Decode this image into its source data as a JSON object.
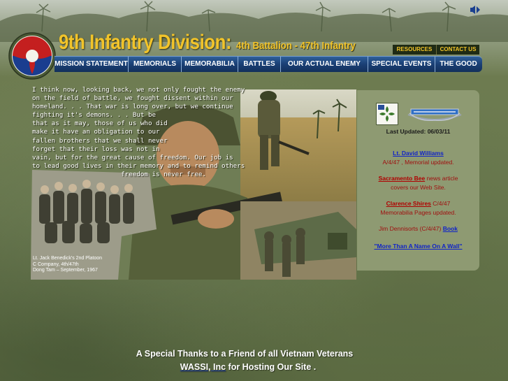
{
  "header": {
    "title_main": "9th Infantry Division:",
    "title_sub": "4th Battalion - 47th Infantry",
    "top_links": [
      "RESOURCES",
      "CONTACT US"
    ]
  },
  "nav": {
    "items": [
      "MISSION STATEMENT",
      "MEMORIALS",
      "MEMORABILIA",
      "BATTLES",
      "OUR ACTUAL ENEMY",
      "SPECIAL EVENTS",
      "THE GOOD"
    ]
  },
  "intro": {
    "lines": [
      "I think now, looking back, we not only fought the enemy",
      "on the field of battle, we fought dissent within our",
      "homeland. . . That war is long over, but we continue",
      "fighting it's demons. . . But be",
      "that as it may, those of us who did",
      "make it have an obligation to our",
      "fallen brothers that we shall never",
      "forget that their loss was not in",
      "vain, but for the great cause of freedom. Our job is",
      "to lead good lives in their memory and to remind others",
      "                       freedom is never free."
    ]
  },
  "caption": {
    "lines": [
      "Lt. Jack Benedick's 2nd Platoon",
      "C Company, 4th/47th",
      "Dong Tam – September, 1967"
    ]
  },
  "panel": {
    "last_updated": "Last Updated: 06/03/11",
    "news": [
      {
        "link": "Lt. David Williams",
        "lines": [
          "A/4/47 , Memorial updated."
        ]
      },
      {
        "link": "Sacramento Bee",
        "after": " news article",
        "lines": [
          "covers our Web Site."
        ]
      },
      {
        "link": "Clarence Shires",
        "after": " C/4/47",
        "lines": [
          "Memorabilia Pages updated."
        ]
      },
      {
        "before": "Jim Dennisorts (C/4/47) ",
        "link": "Book"
      },
      {
        "link": "\"More Than A Name On A Wall\""
      }
    ]
  },
  "footer": {
    "thanks": "A Special Thanks to a Friend of all Vietnam Veterans",
    "host_link": "WASSI, Inc",
    "host_after": " for Hosting Our Site ."
  },
  "colors": {
    "title": "#f2c42a",
    "nav_bg": "#1a3f74",
    "panel_bg": "#8e9a72",
    "link_blue": "#1024c8",
    "link_red": "#b00000"
  },
  "icons": [
    "audio-play-icon",
    "9th-division-patch-logo",
    "4th-infantry-insignia",
    "combat-infantry-badge"
  ]
}
